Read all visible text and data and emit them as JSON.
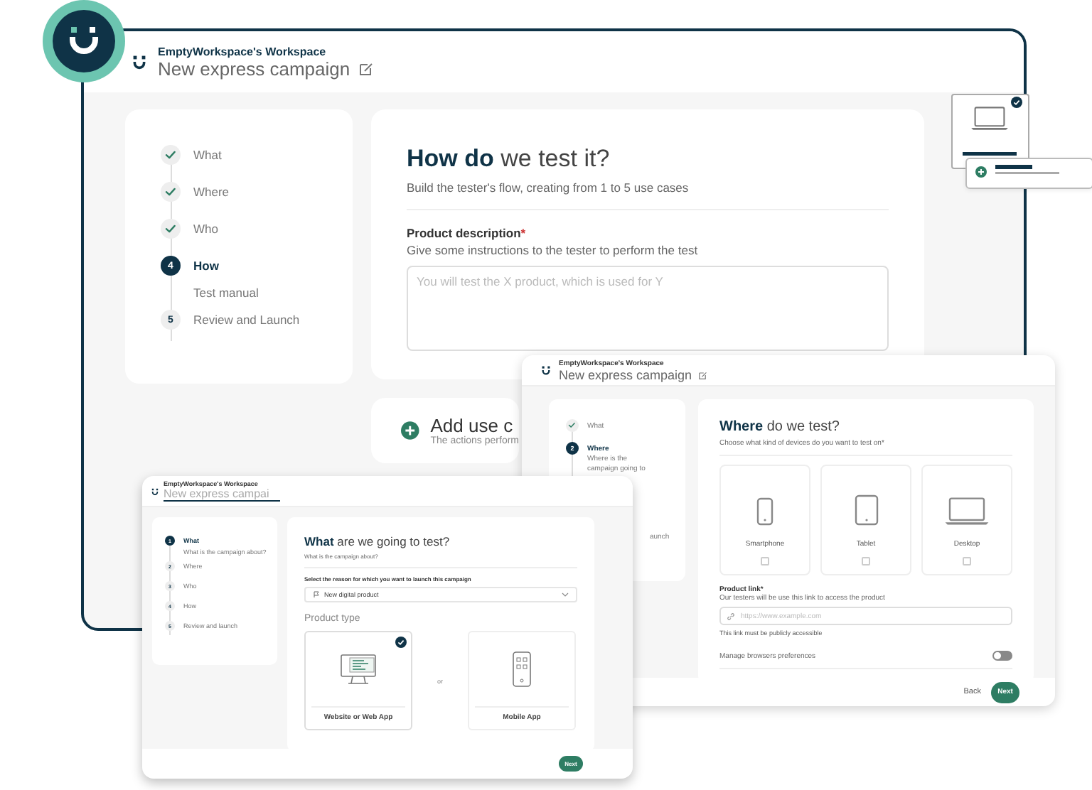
{
  "main_window": {
    "workspace": "EmptyWorkspace's Workspace",
    "campaign": "New express campaign",
    "steps": [
      {
        "label": "What",
        "done": true,
        "selected": false
      },
      {
        "label": "Where",
        "done": true,
        "selected": false
      },
      {
        "label": "Who",
        "done": true,
        "selected": false
      },
      {
        "label": "How",
        "done": false,
        "selected": true,
        "number": "4",
        "children": [
          {
            "label": "Test manual"
          }
        ]
      },
      {
        "label": "Review and Launch",
        "done": false,
        "selected": false,
        "number": "5"
      }
    ],
    "heading": "**How do** we test it?",
    "subtitle": "Build the tester's flow, creating from 1 to 5 use cases",
    "field_label": "Product description",
    "required_mark": "*",
    "field_hint": "Give some instructions to the tester to perform the test",
    "placeholder": "You will test the X product, which is used for Y",
    "add_card": {
      "title": "Add use c",
      "subtitle": "The actions perform"
    }
  },
  "where_window": {
    "workspace": "EmptyWorkspace's Workspace",
    "campaign": "New express campaign",
    "steps": [
      {
        "label": "What",
        "done": true,
        "selected": false
      },
      {
        "label": "Where",
        "done": false,
        "selected": true,
        "number": "2",
        "description": "Where is the campaign going to"
      }
    ],
    "partial_step_label": "aunch",
    "heading": "**Where** do we test?",
    "subtitle": "Choose what kind of devices do you want to test on*",
    "devices": [
      {
        "label": "Smartphone",
        "kind": "phone",
        "checked": false
      },
      {
        "label": "Tablet",
        "kind": "tablet",
        "checked": false
      },
      {
        "label": "Desktop",
        "kind": "laptop",
        "checked": false
      }
    ],
    "link_label": "Product link*",
    "link_hint": "Our testers will be use this link to access the product",
    "link_placeholder": "https://www.example.com",
    "link_note": "This link must be publicly accessible",
    "browsers_toggle": {
      "label": "Manage browsers preferences",
      "on": false
    },
    "buttons": [
      {
        "label": "Back",
        "kind": "text"
      },
      {
        "label": "Next",
        "kind": "primary"
      }
    ]
  },
  "what_window": {
    "workspace": "EmptyWorkspace's Workspace",
    "campaign_value": "New express campai",
    "steps": [
      {
        "label": "What",
        "done": false,
        "selected": true,
        "number": "1",
        "description": "What is the campaign about?"
      },
      {
        "label": "Where",
        "done": false,
        "selected": false,
        "number": "2"
      },
      {
        "label": "Who",
        "done": false,
        "selected": false,
        "number": "3"
      },
      {
        "label": "How",
        "done": false,
        "selected": false,
        "number": "4"
      },
      {
        "label": "Review and launch",
        "done": false,
        "selected": false,
        "number": "5"
      }
    ],
    "heading": "**What** are we going to test?",
    "subtitle": "What is the campaign about?",
    "select_label": "Select the reason for which you want to launch this campaign",
    "select_value": "New digital product",
    "product_type_label": "Product type",
    "product_types": [
      {
        "label": "Website or Web App",
        "kind": "web",
        "selected": true
      },
      {
        "label": "Mobile App",
        "kind": "mobile",
        "selected": false
      }
    ],
    "separator": "or",
    "buttons": [
      {
        "label": "Next",
        "kind": "primary"
      }
    ]
  }
}
